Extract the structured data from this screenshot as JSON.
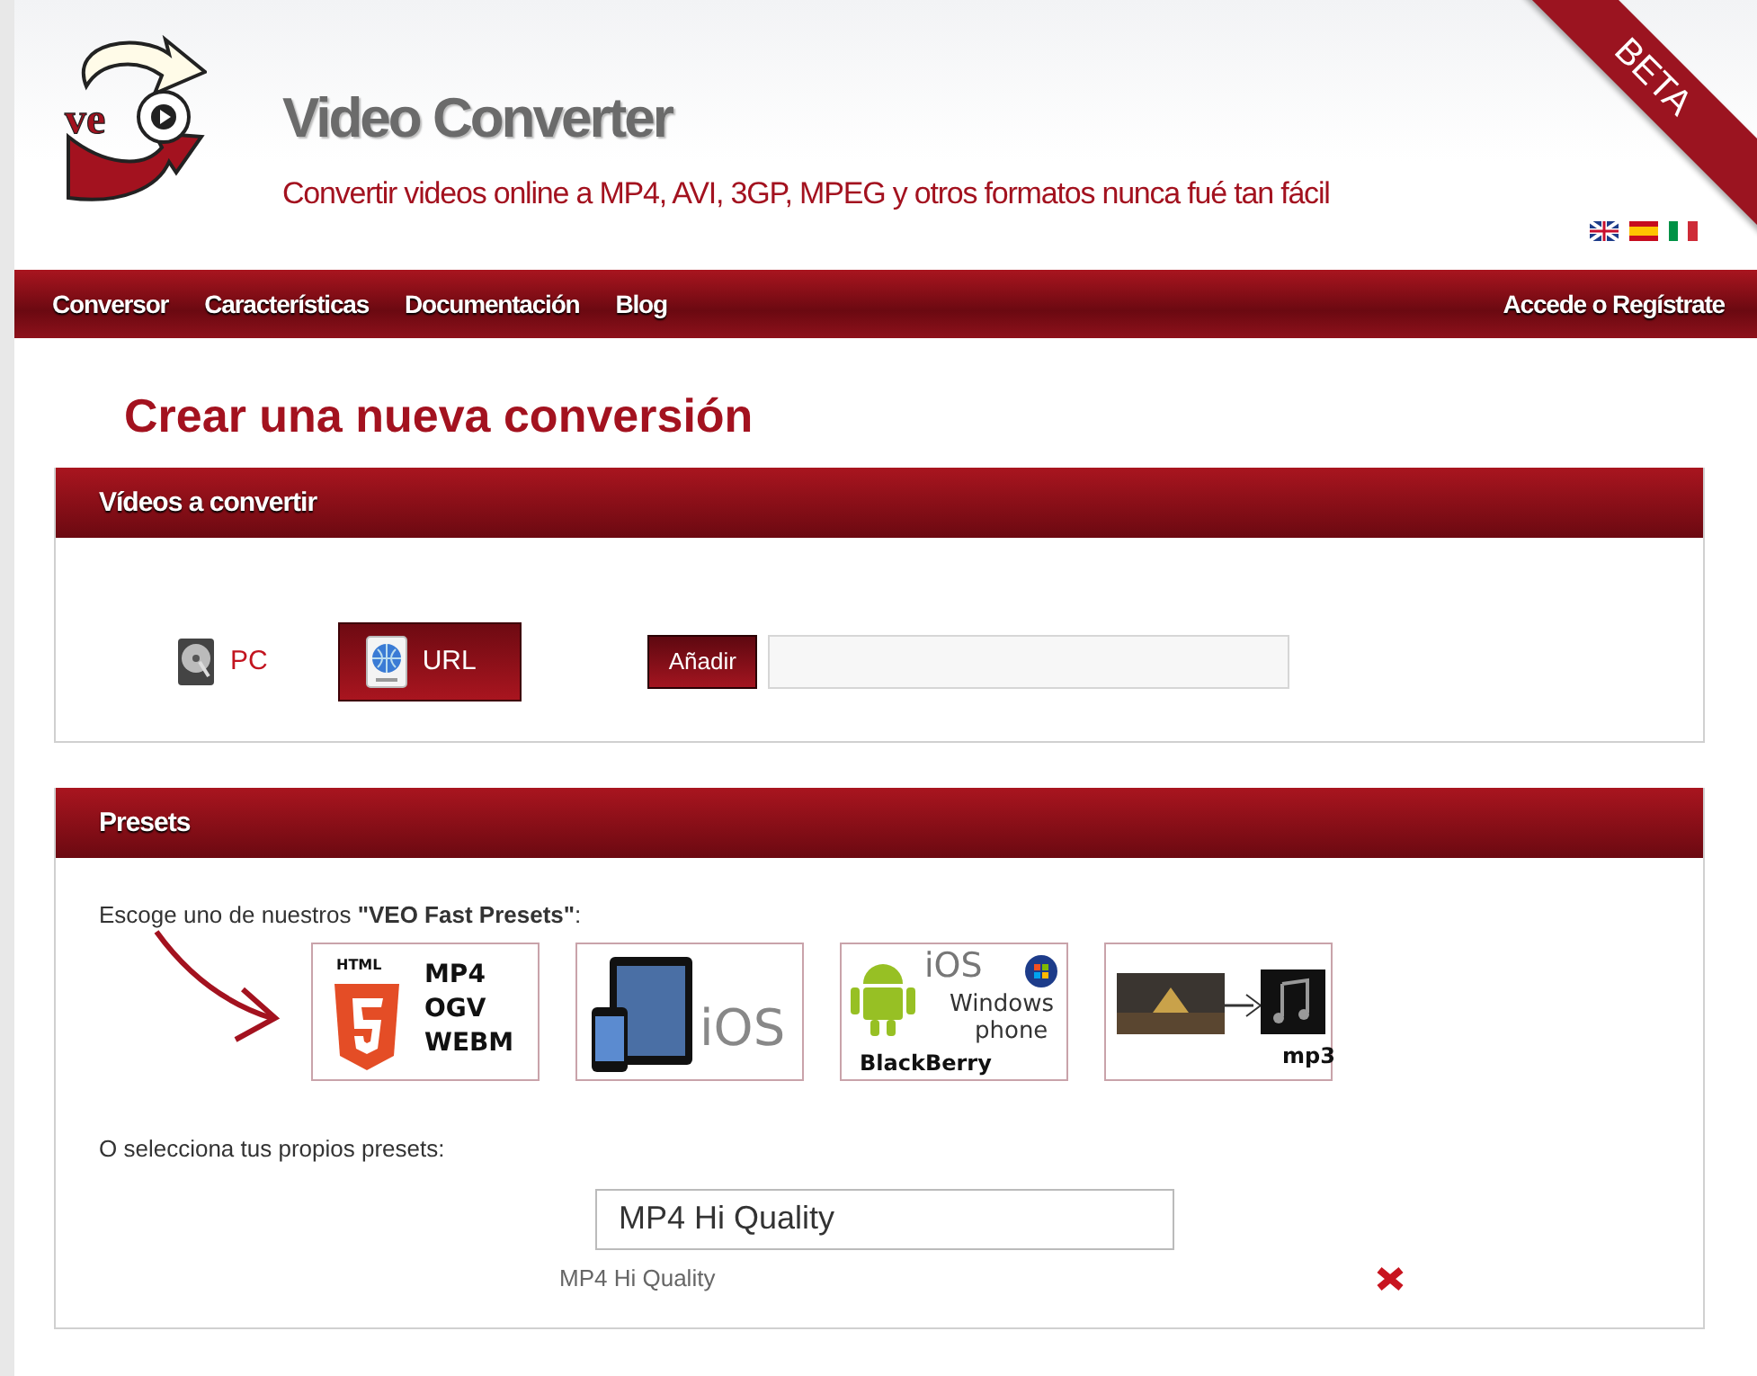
{
  "header": {
    "logo_text": "ve",
    "title": "Video Converter",
    "tagline": "Convertir videos online a MP4, AVI, 3GP, MPEG y otros formatos nunca fué tan fácil",
    "badge": "BETA"
  },
  "nav": {
    "items": [
      "Conversor",
      "Características",
      "Documentación",
      "Blog"
    ],
    "account_link": "Accede o Regístrate"
  },
  "page_title": "Crear una nueva conversión",
  "sources": {
    "title": "Vídeos a convertir",
    "options": [
      {
        "kind": "pc",
        "label": "PC",
        "selected": false
      },
      {
        "kind": "url",
        "label": "URL",
        "selected": true
      }
    ],
    "add_button": "Añadir"
  },
  "presets": {
    "title": "Presets",
    "intro": "Escoge uno de nuestros **\"VEO Fast Presets\"**:",
    "tiles": [
      {
        "kind": "html5",
        "labels": [
          "HTML",
          "MP4",
          "OGV",
          "WEBM"
        ]
      },
      {
        "kind": "ios",
        "labels": [
          "iOS"
        ]
      },
      {
        "kind": "mobile",
        "labels": [
          "iOS",
          "Windows",
          "phone",
          "BlackBerry"
        ]
      },
      {
        "kind": "audio",
        "labels": [
          "mp3"
        ]
      }
    ],
    "custom_label": "O selecciona tus propios presets:",
    "select_value": "MP4 Hi Quality",
    "chosen": [
      "MP4 Hi Quality"
    ]
  }
}
